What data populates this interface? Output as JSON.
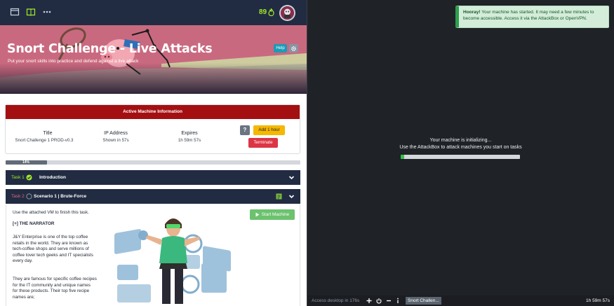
{
  "topbar": {
    "streak": "89"
  },
  "room": {
    "title": "Snort Challenge - Live Attacks",
    "subtitle": "Put your snort skills into practice and defend against a live attack",
    "help_label": "Help"
  },
  "machine": {
    "header": "Active Machine Information",
    "columns": [
      {
        "label": "Title",
        "value": "Snort Challenge 1 PROD-v0.3"
      },
      {
        "label": "IP Address",
        "value": "Shown in 57s"
      },
      {
        "label": "Expires",
        "value": "1h 59m 57s"
      }
    ],
    "question_label": "?",
    "add_hour_label": "Add 1 hour",
    "terminate_label": "Terminate"
  },
  "progress": {
    "label": "14%",
    "value": 0.14
  },
  "tasks": [
    {
      "number": "Task 1",
      "title": "Introduction",
      "status": "complete"
    },
    {
      "number": "Task 2",
      "title": "Scenario 1 | Brute-Force",
      "status": "incomplete"
    }
  ],
  "task2": {
    "intro": "Use the attached VM to finish this task.",
    "start_label": "Start Machine",
    "heading": "[+] THE NARRATOR",
    "para1": [
      "J&Y Enterprise is one of the top coffee",
      "retails in the world. They are known as",
      "tech-coffee shops and serve millions of",
      "coffee lover tech geeks and IT specialists",
      "every day."
    ],
    "para2": [
      "They are famous for specific coffee recipes",
      "for the IT community and unique names",
      "for these products. Their top five recipe",
      "names are;"
    ]
  },
  "toast": {
    "title": "Hooray!",
    "message": "Your machine has started. It may need a few minutes to become accessible. Access it via the AttackBox or OpenVPN."
  },
  "init": {
    "line1": "Your machine is initializing...",
    "line2": "Use the AttackBox to attack machines you start on tasks",
    "progress": 0.03
  },
  "statusbar": {
    "access": "Access desktop in 176s",
    "tab": "Snort Challen...",
    "time": "1h 59m 57s"
  },
  "colors": {
    "accent_green": "#a3ea2a",
    "machine_header": "#a40f12",
    "nav": "#212c42"
  }
}
